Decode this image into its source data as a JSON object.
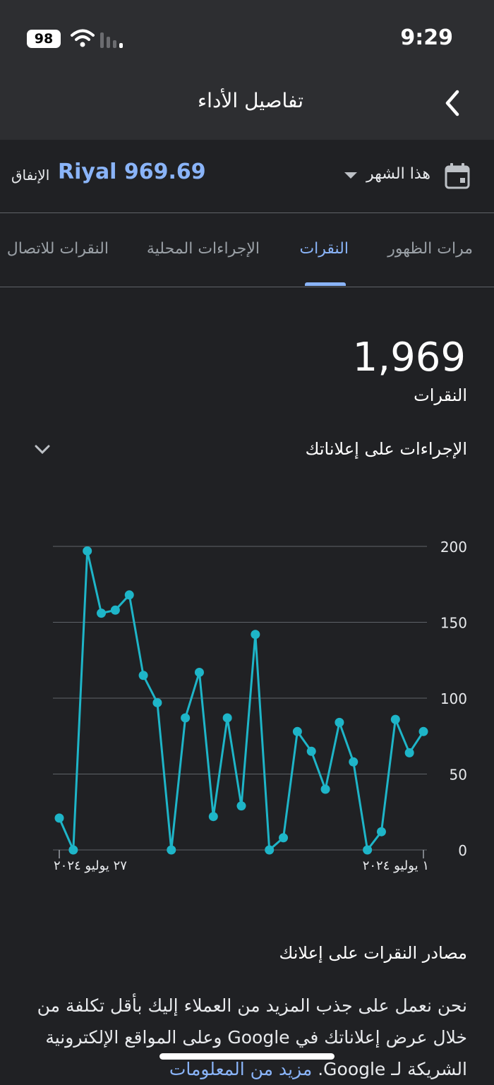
{
  "status_bar": {
    "time": "9:29",
    "battery": "98"
  },
  "header": {
    "title": "تفاصيل الأداء",
    "back_icon": "chevron-left-icon"
  },
  "filters": {
    "spend_label": "الإنفاق",
    "spend_value": "Riyal 969.69",
    "period": "هذا الشهر",
    "calendar_icon": "calendar-icon"
  },
  "tabs": [
    {
      "label": "مرات الظهور",
      "active": false
    },
    {
      "label": "النقرات",
      "active": true
    },
    {
      "label": "الإجراءات المحلية",
      "active": false
    },
    {
      "label": "النقرات للاتصال",
      "active": false
    }
  ],
  "metric": {
    "value": "1,969",
    "label": "النقرات"
  },
  "actions_section": {
    "label": "الإجراءات على إعلاناتك",
    "expand_icon": "chevron-down-icon"
  },
  "chart_data": {
    "type": "line",
    "x_start_label": "١ يوليو ٢٠٢٤",
    "x_end_label": "٢٧ يوليو ٢٠٢٤",
    "y_ticks": [
      0,
      50,
      100,
      150,
      200
    ],
    "ylim": [
      0,
      200
    ],
    "x_direction": "right-to-left",
    "series": [
      {
        "color": "#1eb5c8",
        "values": [
          78,
          64,
          86,
          12,
          0,
          58,
          84,
          40,
          65,
          78,
          8,
          0,
          142,
          29,
          87,
          22,
          117,
          87,
          0,
          97,
          115,
          168,
          158,
          156,
          197,
          0,
          21
        ]
      }
    ]
  },
  "sources": {
    "title": "مصادر النقرات على إعلانك",
    "description": "نحن نعمل على جذب المزيد من العملاء إليك بأقل تكلفة من خلال عرض إعلاناتك في Google وعلى المواقع الإلكترونية الشريكة لـ Google.",
    "more_link": "مزيد من المعلومات"
  }
}
